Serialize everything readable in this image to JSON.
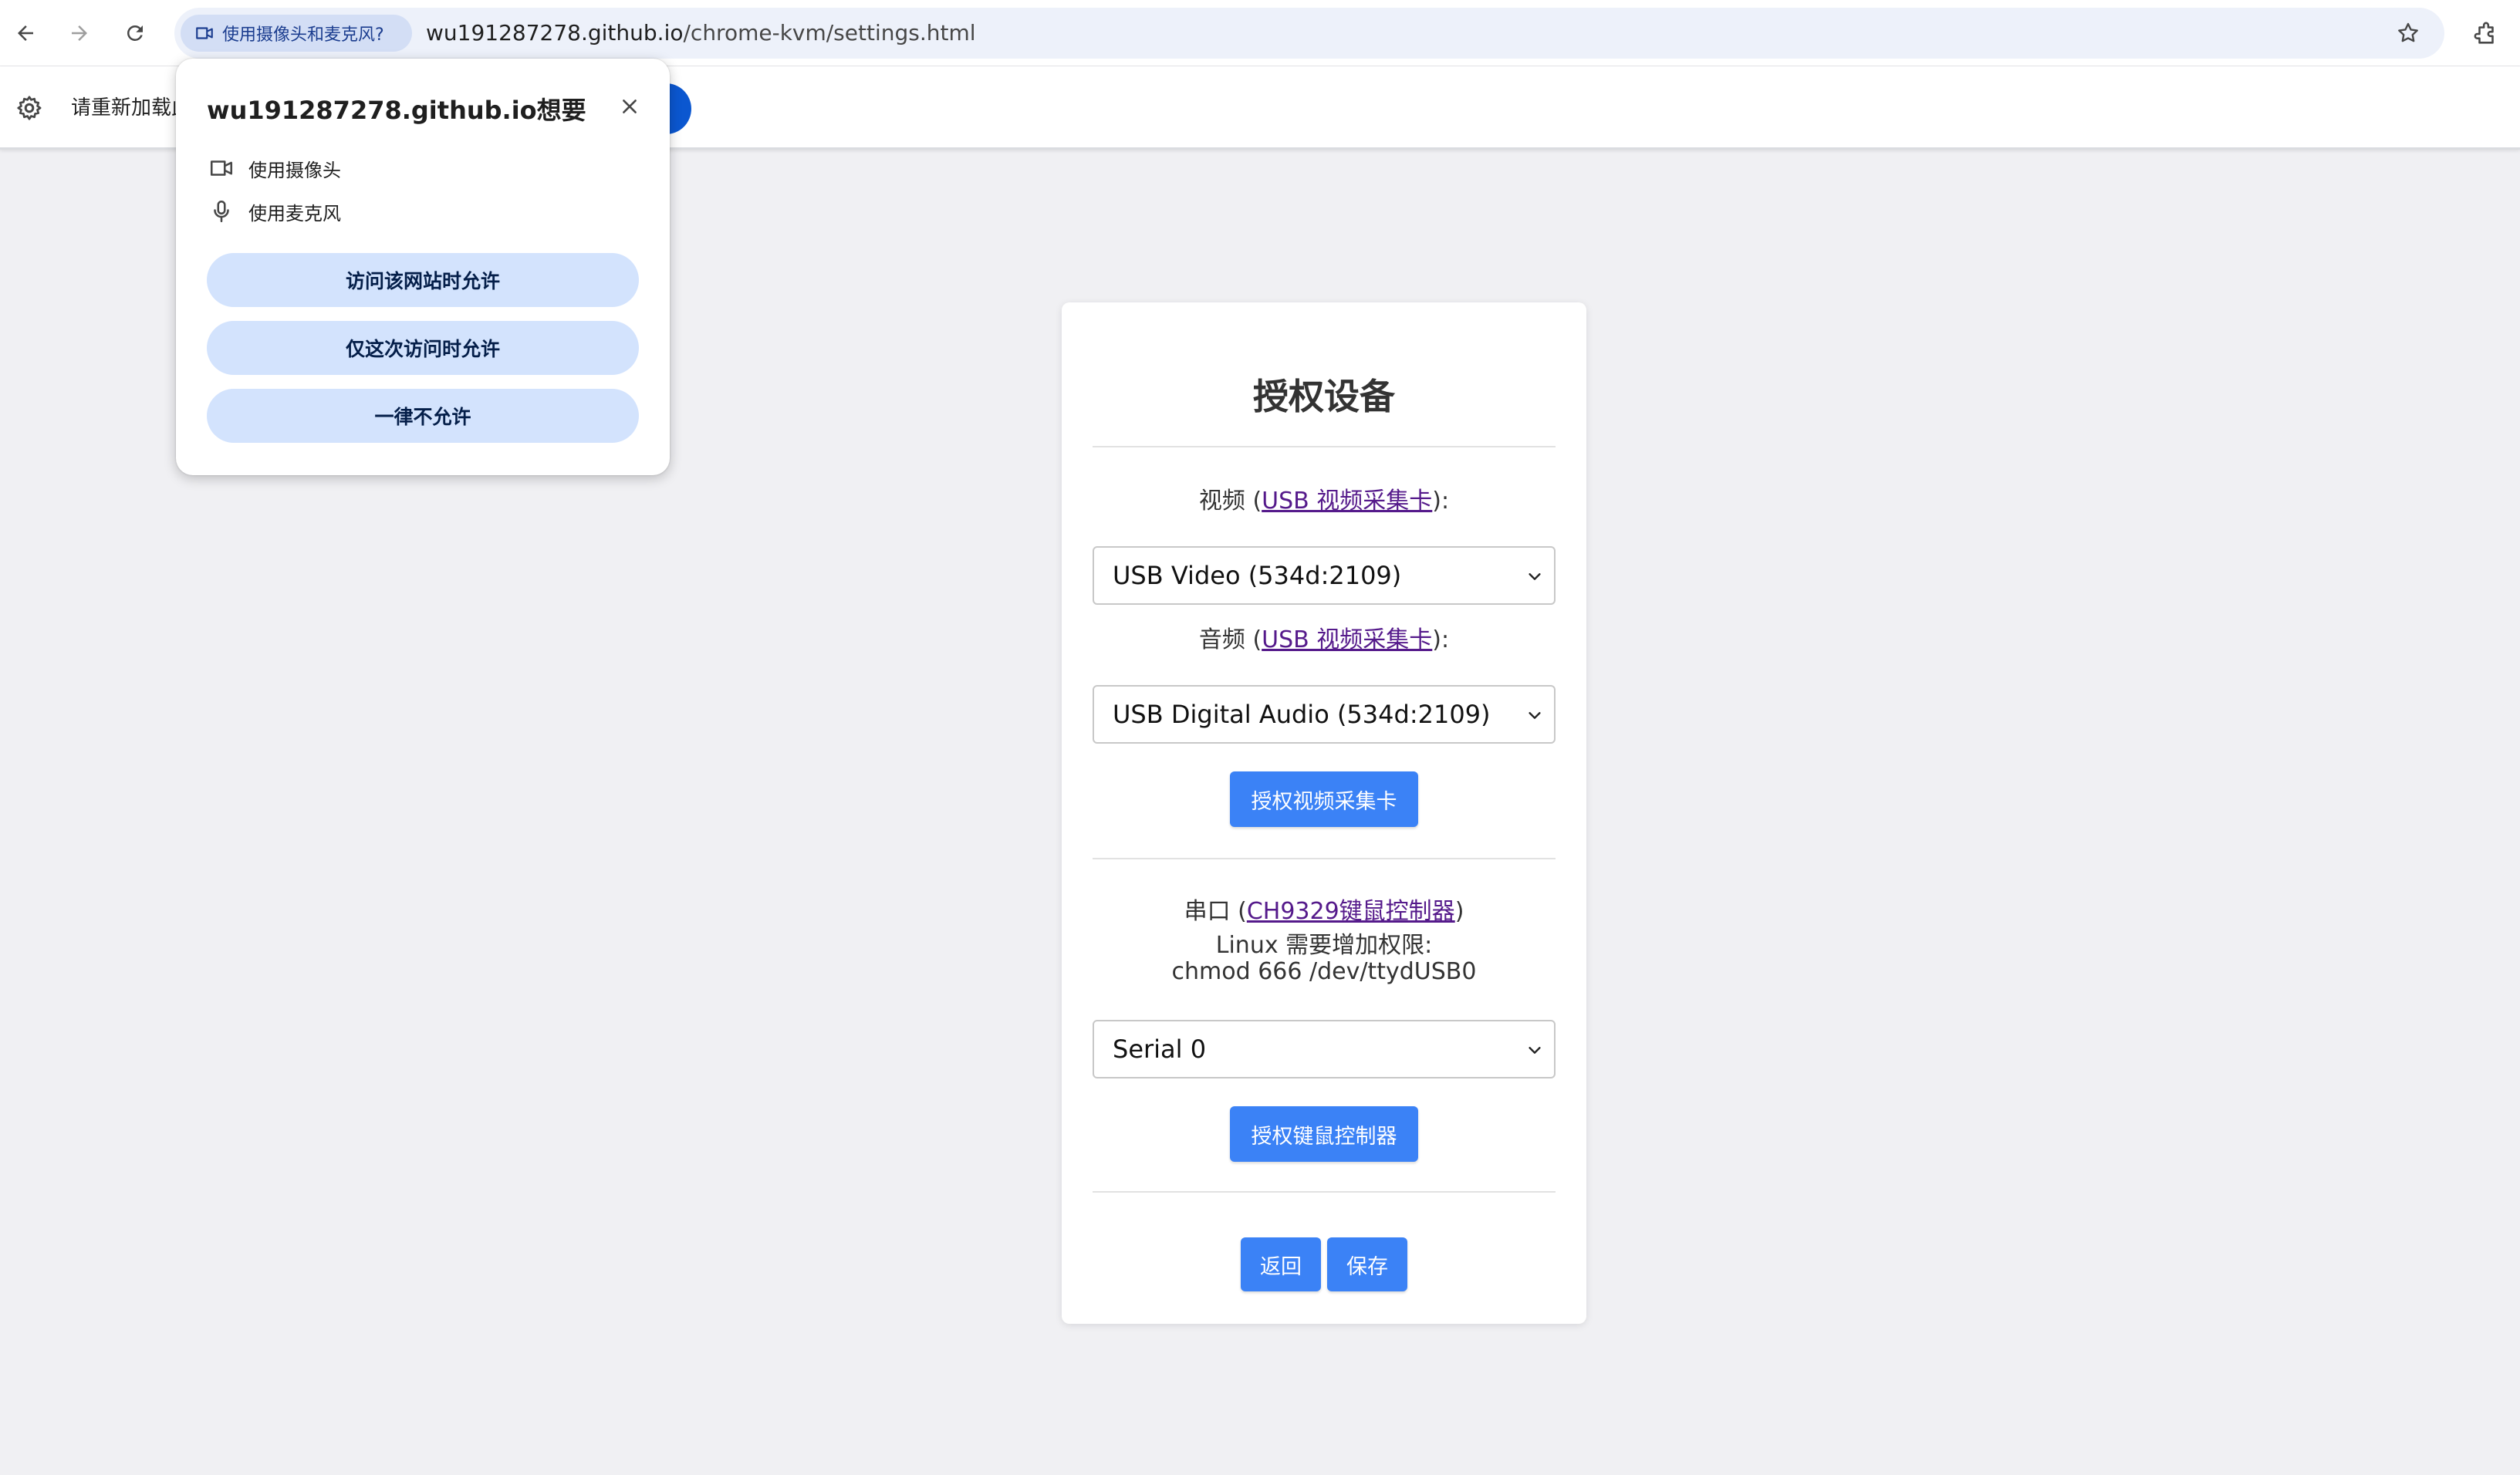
{
  "browser": {
    "permission_chip": "使用摄像头和麦克风?",
    "url_domain": "wu191287278.github.io",
    "url_path": "/chrome-kvm/settings.html",
    "icons": [
      "back-icon",
      "forward-icon",
      "reload-icon",
      "camera-icon",
      "star-icon",
      "extensions-icon"
    ]
  },
  "infobar": {
    "text": "请重新加载此"
  },
  "popup": {
    "title": "wu191287278.github.io想要",
    "permissions": [
      {
        "icon": "camera-icon",
        "label": "使用摄像头"
      },
      {
        "icon": "mic-icon",
        "label": "使用麦克风"
      }
    ],
    "buttons": {
      "allow_always": "访问该网站时允许",
      "allow_once": "仅这次访问时允许",
      "never": "一律不允许"
    }
  },
  "card": {
    "title": "授权设备",
    "video": {
      "label_prefix": "视频 (",
      "link": "USB 视频采集卡",
      "label_suffix": "):",
      "selected": "USB Video (534d:2109)"
    },
    "audio": {
      "label_prefix": "音频 (",
      "link": "USB 视频采集卡",
      "label_suffix": "):",
      "selected": "USB Digital Audio (534d:2109)"
    },
    "authorize_capture_button": "授权视频采集卡",
    "serial": {
      "label_prefix": "串口 (",
      "link": "CH9329键鼠控制器",
      "label_suffix": ")",
      "note_line1": "Linux 需要增加权限:",
      "note_line2": "chmod 666 /dev/ttydUSB0",
      "selected": "Serial 0"
    },
    "authorize_controller_button": "授权键鼠控制器",
    "back_button": "返回",
    "save_button": "保存"
  },
  "colors": {
    "primary_button": "#3b82f6",
    "popup_button": "#d3e3fd",
    "link": "#551a8b",
    "background": "#f0f0f3"
  }
}
